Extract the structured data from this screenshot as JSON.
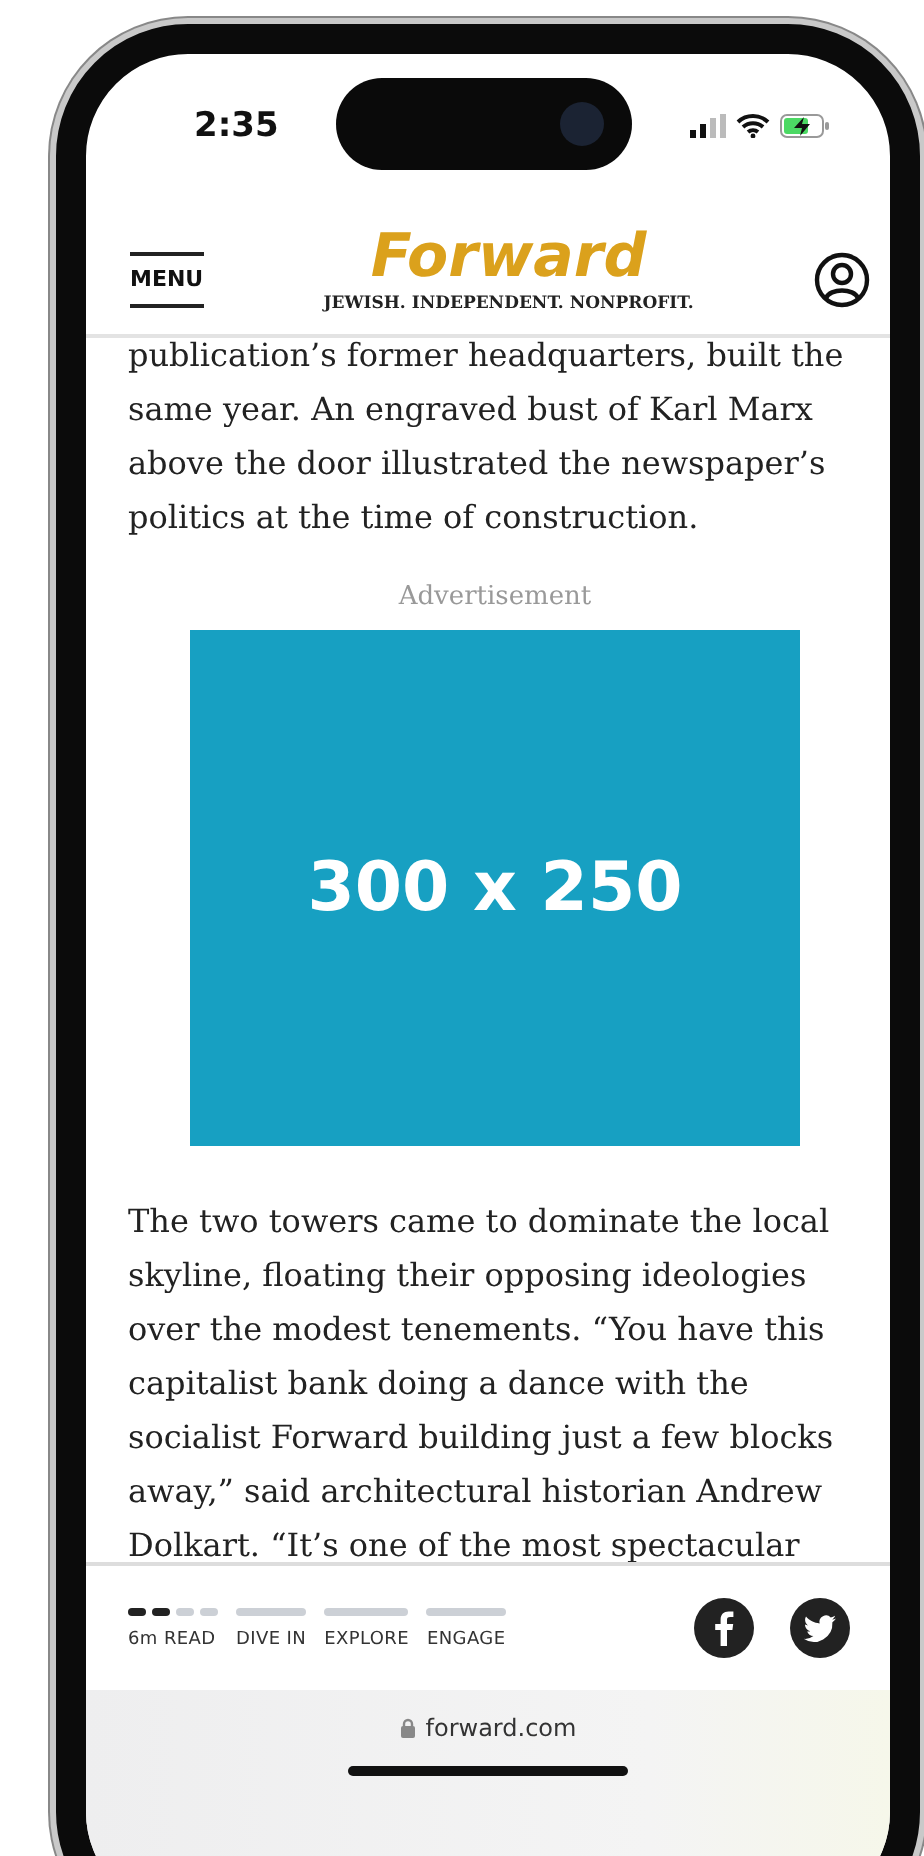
{
  "status_bar": {
    "time": "2:35"
  },
  "header": {
    "menu": "MENU",
    "logo": "Forward",
    "tagline": "JEWISH. INDEPENDENT. NONPROFIT."
  },
  "article": {
    "paragraph_1": "publication’s former headquarters, built the same year. An engraved bust of Karl Marx above the door illustrated the newspaper’s politics at the time of construction.",
    "ad_label": "Advertisement",
    "ad_text": "300 x 250",
    "paragraph_2": "The two towers came to dominate the local skyline, floating their opposing ideologies over the modest tenements. “You have this capitalist bank doing a dance with the socialist Forward building just a few blocks away,” said architectural historian Andrew Dolkart. “It’s one of the most spectacular"
  },
  "progress": [
    {
      "label": "6m READ",
      "kind": "dashed"
    },
    {
      "label": "DIVE IN",
      "kind": "solid"
    },
    {
      "label": "EXPLORE",
      "kind": "solid"
    },
    {
      "label": "ENGAGE",
      "kind": "solid"
    }
  ],
  "url_bar": {
    "url": "forward.com"
  }
}
